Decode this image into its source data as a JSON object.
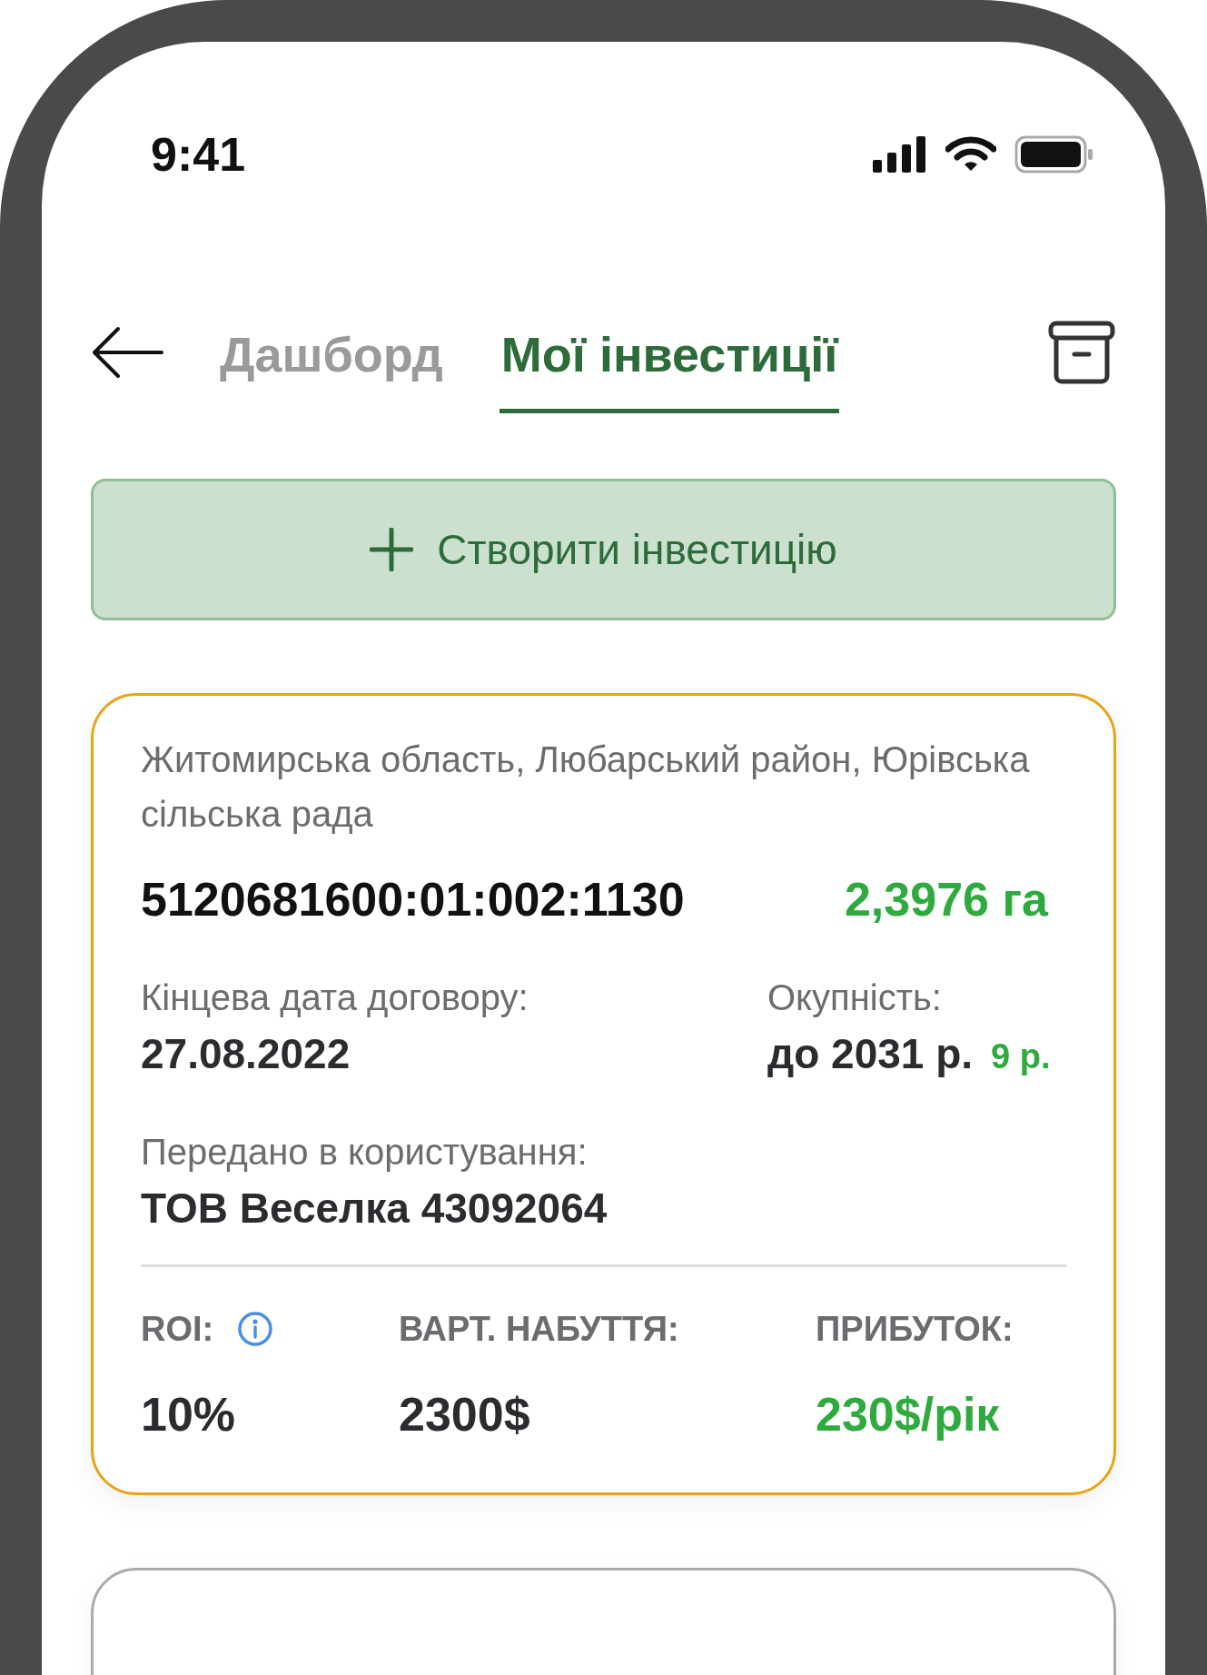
{
  "status_bar": {
    "time": "9:41"
  },
  "tabs": [
    {
      "label": "Дашборд",
      "selected": false
    },
    {
      "label": "Мої інвестиції",
      "selected": true
    }
  ],
  "create_button": {
    "label": "Створити інвестицію"
  },
  "investments": [
    {
      "selected": true,
      "address": "Житомирська область, Любарський район, Юрівська сільська рада",
      "cadastral_number": "5120681600:01:002:1130",
      "area": "2,3976 га",
      "contract_end_label": "Кінцева дата договору:",
      "contract_end": "27.08.2022",
      "payback_label": "Окупність:",
      "payback": "до 2031 р.",
      "payback_years": "9 р.",
      "user_label": "Передано в користування:",
      "user": "ТОВ Веселка 43092064",
      "roi_label": "ROI:",
      "roi": "10%",
      "cost_label": "ВАРТ. НАБУТТЯ:",
      "cost": "2300$",
      "profit_label": "ПРИБУТОК:",
      "profit": "230$/рік"
    },
    {
      "selected": false
    }
  ]
}
